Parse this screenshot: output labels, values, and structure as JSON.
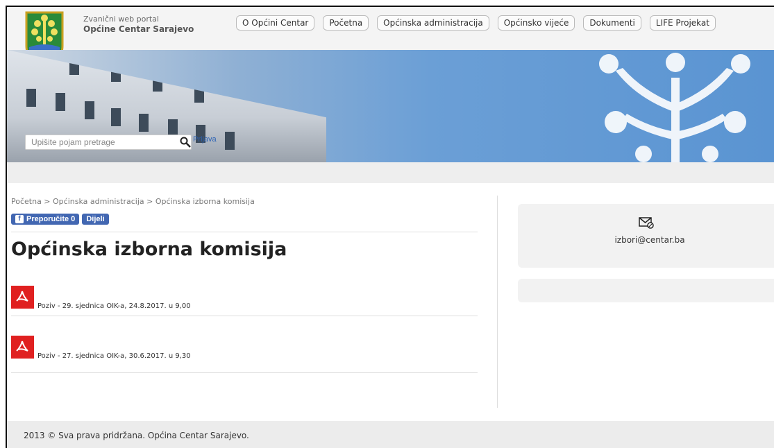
{
  "header": {
    "portal_line": "Zvanični web portal",
    "portal_name": "Općine Centar Sarajevo",
    "nav": [
      "O Općini Centar",
      "Početna",
      "Općinska administracija",
      "Općinsko vijeće",
      "Dokumenti",
      "LIFE Projekat"
    ]
  },
  "banner": {
    "search_placeholder": "Upišite pojam pretrage",
    "login_label": "Prijava"
  },
  "main": {
    "breadcrumb": "Početna > Općinska administracija > Općinska izborna komisija",
    "fb_recommend": "Preporučite 0",
    "fb_share": "Dijeli",
    "title": "Općinska izborna komisija",
    "documents": [
      "Poziv - 29. sjednica OIK-a, 24.8.2017. u 9,00",
      "Poziv - 27. sjednica OIK-a, 30.6.2017. u 9,30"
    ]
  },
  "sidebar": {
    "email": "izbori@centar.ba"
  },
  "footer": {
    "text": "2013 © Sva prava pridržana. Općina Centar Sarajevo."
  },
  "colors": {
    "facebook_blue": "#4267b2",
    "pdf_red": "#e02020",
    "link_blue": "#2a62b6"
  }
}
